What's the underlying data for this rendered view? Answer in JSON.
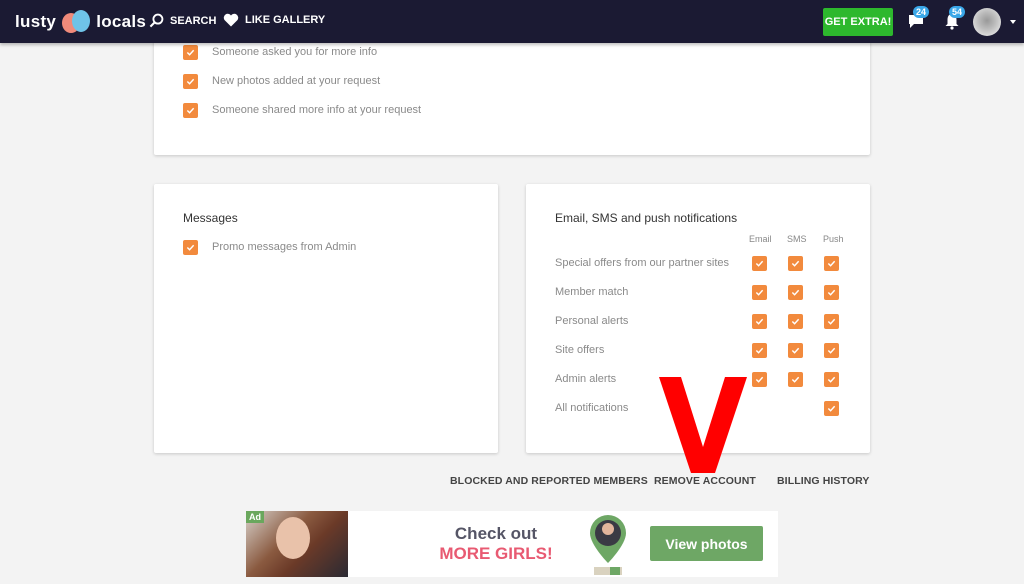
{
  "header": {
    "logo_left": "lusty",
    "logo_right": "locals",
    "nav": [
      {
        "label": "SEARCH",
        "icon": "search-icon"
      },
      {
        "label": "LIKE GALLERY",
        "icon": "heart-icon"
      }
    ],
    "cta_label": "GET EXTRA!",
    "messages_count": "24",
    "notifications_count": "54",
    "colors": {
      "bar": "#1b1a33",
      "cta": "#2db82d",
      "badge": "#3aa7e8"
    }
  },
  "top_card": {
    "items": [
      {
        "label": "Someone asked you for more info",
        "checked": true
      },
      {
        "label": "New photos added at your request",
        "checked": true
      },
      {
        "label": "Someone shared more info at your request",
        "checked": true
      }
    ]
  },
  "messages_card": {
    "title": "Messages",
    "items": [
      {
        "label": "Promo messages from Admin",
        "checked": true
      }
    ]
  },
  "notifications_card": {
    "title": "Email, SMS and push notifications",
    "columns": [
      "Email",
      "SMS",
      "Push"
    ],
    "rows": [
      {
        "label": "Special offers from our partner sites",
        "email": true,
        "sms": true,
        "push": true
      },
      {
        "label": "Member match",
        "email": true,
        "sms": true,
        "push": true
      },
      {
        "label": "Personal alerts",
        "email": true,
        "sms": true,
        "push": true
      },
      {
        "label": "Site offers",
        "email": true,
        "sms": true,
        "push": true
      },
      {
        "label": "Admin alerts",
        "email": true,
        "sms": true,
        "push": true
      },
      {
        "label": "All notifications",
        "email": false,
        "sms": false,
        "push": true
      }
    ]
  },
  "footer_links": {
    "blocked": "BLOCKED AND REPORTED MEMBERS",
    "remove": "REMOVE ACCOUNT",
    "billing": "BILLING HISTORY"
  },
  "annotation": {
    "mark": "V",
    "color": "#ff0000"
  },
  "ad": {
    "tag": "Ad",
    "line1": "Check out",
    "line2": "MORE GIRLS!",
    "button": "View photos"
  },
  "accent_color": "#f28a3d"
}
